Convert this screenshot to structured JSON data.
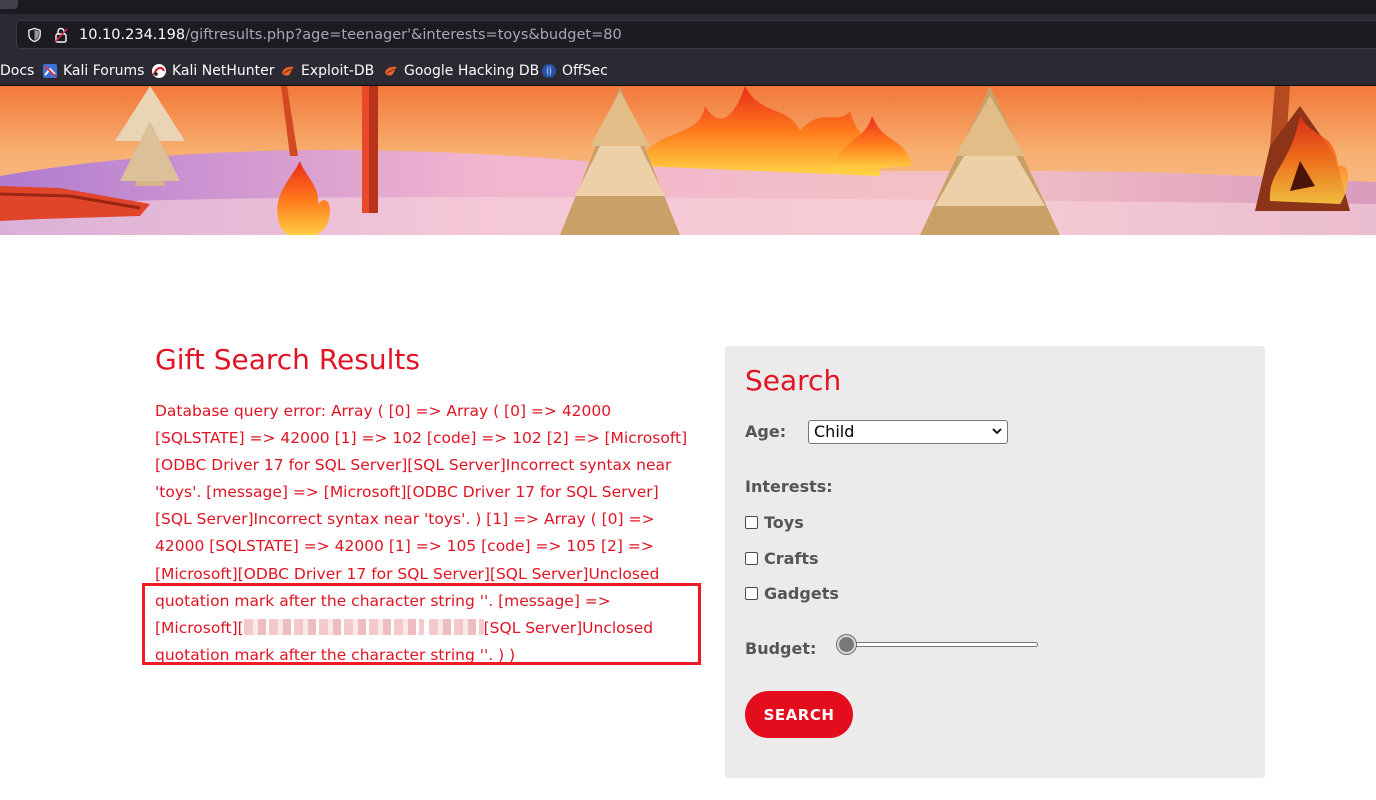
{
  "browser": {
    "url_host": "10.10.234.198",
    "url_path": "/giftresults.php?age=teenager'&interests=toys&budget=80",
    "bookmarks": [
      {
        "label": "Docs",
        "icon": "docs-icon"
      },
      {
        "label": "Kali Forums",
        "icon": "kali-forums-icon"
      },
      {
        "label": "Kali NetHunter",
        "icon": "kali-nethunter-icon"
      },
      {
        "label": "Exploit-DB",
        "icon": "exploit-db-icon"
      },
      {
        "label": "Google Hacking DB",
        "icon": "google-hacking-db-icon"
      },
      {
        "label": "OffSec",
        "icon": "offsec-icon"
      }
    ]
  },
  "results": {
    "title": "Gift Search Results",
    "error_part1": "Database query error: Array ( [0] => Array ( [0] => 42000 [SQLSTATE] => 42000 [1] => 102 [code] => 102 [2] => [Microsoft][ODBC Driver 17 for SQL Server][SQL Server]Incorrect syntax near 'toys'. [message] => [Microsoft][ODBC Driver 17 for SQL Server][SQL Server]Incorrect syntax near 'toys'. ) [1] => Array ( [0] => 42000 [SQLSTATE] => 42000 [1] => 105 [code] => 105 [2] => [Microsoft][ODBC Driver 17 for SQL Server][SQL Server]Unclosed quotation mark after the character string ''. [message] => [Microsoft][",
    "error_part2": "[SQL Server]Unclosed quotation mark after the character string ''. ) )"
  },
  "search": {
    "title": "Search",
    "age_label": "Age:",
    "age_selected": "Child",
    "interests_label": "Interests:",
    "interests": [
      "Toys",
      "Crafts",
      "Gadgets"
    ],
    "budget_label": "Budget:",
    "budget_fraction": 0.0,
    "button_label": "SEARCH"
  },
  "colors": {
    "accent": "#e01424",
    "highlight_box": "#ee1c25",
    "panel_bg": "#ebebeb"
  }
}
